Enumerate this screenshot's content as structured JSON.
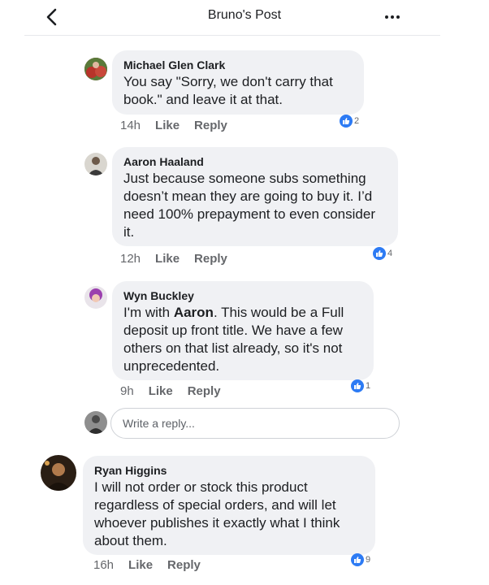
{
  "header": {
    "title": "Bruno's Post"
  },
  "input": {
    "placeholder": "Write a reply..."
  },
  "comments": [
    {
      "name": "Michael Glen Clark",
      "text": "You say \"Sorry, we don't carry that book.\" and leave it at that.",
      "time": "14h",
      "like_label": "Like",
      "reply_label": "Reply",
      "reactions": "2"
    },
    {
      "name": "Aaron Haaland",
      "text": "Just because someone subs something doesn’t mean they are going to buy it. I’d need 100% prepayment to even consider it.",
      "time": "12h",
      "like_label": "Like",
      "reply_label": "Reply",
      "reactions": "4"
    },
    {
      "name": "Wyn Buckley",
      "mention": "Aaron",
      "text_before": "I'm with ",
      "text_after": ". This would be a Full deposit up front title. We have a few others on that list already, so it's not unprecedented.",
      "time": "9h",
      "like_label": "Like",
      "reply_label": "Reply",
      "reactions": "1"
    },
    {
      "name": "Ryan Higgins",
      "text": "I will not order or stock this product regardless of special orders, and will let whoever publishes it exactly what I think about them.",
      "time": "16h",
      "like_label": "Like",
      "reply_label": "Reply",
      "reactions": "9"
    }
  ],
  "colors": {
    "accent": "#2d7bf4",
    "bubble": "#f0f1f4",
    "meta": "#65676b"
  },
  "icons": {
    "back": "chevron-left-icon",
    "more": "more-dots-icon",
    "reaction": "like-thumb-icon"
  }
}
